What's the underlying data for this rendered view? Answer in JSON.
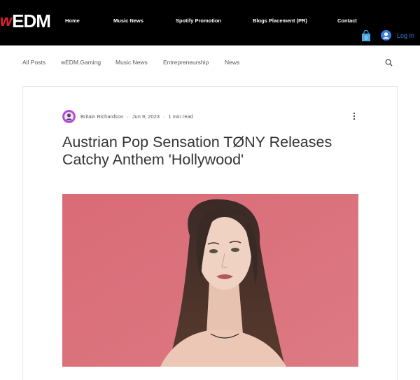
{
  "header": {
    "logo": {
      "prefix": "w",
      "main": "EDM"
    },
    "nav": [
      {
        "label": "Home"
      },
      {
        "label": "Music News"
      },
      {
        "label": "Spotify Promotion"
      },
      {
        "label": "Blogs Placement (PR)"
      },
      {
        "label": "Contact"
      }
    ],
    "cart_count": "0",
    "login_label": "Log In"
  },
  "categories": [
    {
      "label": "All Posts"
    },
    {
      "label": "wEDM.Gaming"
    },
    {
      "label": "Music News"
    },
    {
      "label": "Entrepreneurship"
    },
    {
      "label": "News"
    }
  ],
  "post": {
    "author": "Britain Richardson",
    "date": "Jun 9, 2023",
    "read_time": "1 min read",
    "title": "Austrian Pop Sensation TØNY Releases Catchy Anthem 'Hollywood'"
  },
  "colors": {
    "header_bg": "#000000",
    "logo_red": "#e0212a",
    "accent_blue": "#3b7dd8",
    "hero_bg": "#d9707a"
  }
}
